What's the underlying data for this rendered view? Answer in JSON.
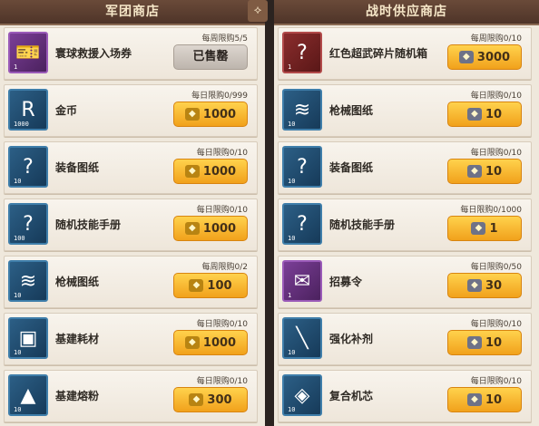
{
  "left_panel": {
    "title": "军团商店",
    "items": [
      {
        "name": "寰球救援入场券",
        "limit": "每周限购5/5",
        "quantity": "1",
        "sold_out": true,
        "button_label": "已售罄",
        "price": "",
        "icon": "ticket-icon",
        "tier": "purple"
      },
      {
        "name": "金币",
        "limit": "每日限购0/999",
        "quantity": "1000",
        "sold_out": false,
        "button_label": "",
        "price": "1000",
        "icon": "gold-coin-icon",
        "tier": "blue"
      },
      {
        "name": "装备图纸",
        "limit": "每日限购0/10",
        "quantity": "10",
        "sold_out": false,
        "button_label": "",
        "price": "1000",
        "icon": "equipment-blueprint-icon",
        "tier": "blue"
      },
      {
        "name": "随机技能手册",
        "limit": "每日限购0/10",
        "quantity": "100",
        "sold_out": false,
        "button_label": "",
        "price": "1000",
        "icon": "skill-manual-icon",
        "tier": "blue"
      },
      {
        "name": "枪械图纸",
        "limit": "每周限购0/2",
        "quantity": "10",
        "sold_out": false,
        "button_label": "",
        "price": "100",
        "icon": "firearm-blueprint-icon",
        "tier": "blue"
      },
      {
        "name": "基建耗材",
        "limit": "每日限购0/10",
        "quantity": "10",
        "sold_out": false,
        "button_label": "",
        "price": "1000",
        "icon": "construction-material-icon",
        "tier": "blue"
      },
      {
        "name": "基建熔粉",
        "limit": "每日限购0/10",
        "quantity": "10",
        "sold_out": false,
        "button_label": "",
        "price": "300",
        "icon": "construction-powder-icon",
        "tier": "blue"
      }
    ]
  },
  "right_panel": {
    "title": "战时供应商店",
    "items": [
      {
        "name": "红色超武碎片随机箱",
        "limit": "每周限购0/10",
        "quantity": "1",
        "price": "3000",
        "icon": "red-weapon-chest-icon",
        "tier": "red"
      },
      {
        "name": "枪械图纸",
        "limit": "每日限购0/10",
        "quantity": "10",
        "price": "10",
        "icon": "firearm-blueprint-icon",
        "tier": "blue"
      },
      {
        "name": "装备图纸",
        "limit": "每日限购0/10",
        "quantity": "10",
        "price": "10",
        "icon": "equipment-blueprint-icon",
        "tier": "blue"
      },
      {
        "name": "随机技能手册",
        "limit": "每日限购0/1000",
        "quantity": "10",
        "price": "1",
        "icon": "skill-manual-icon",
        "tier": "blue"
      },
      {
        "name": "招募令",
        "limit": "每日限购0/50",
        "quantity": "1",
        "price": "30",
        "icon": "recruit-order-icon",
        "tier": "purple"
      },
      {
        "name": "强化补剂",
        "limit": "每日限购0/10",
        "quantity": "10",
        "price": "10",
        "icon": "enhancement-syringe-icon",
        "tier": "blue"
      },
      {
        "name": "复合机芯",
        "limit": "每日限购0/10",
        "quantity": "10",
        "price": "10",
        "icon": "composite-core-icon",
        "tier": "blue"
      }
    ]
  },
  "colors": {
    "panel_bg": "#efe8dc",
    "header_bg": "#5c3f31",
    "buy_button": "#ffc83a",
    "sold_button": "#cfc7bf"
  }
}
